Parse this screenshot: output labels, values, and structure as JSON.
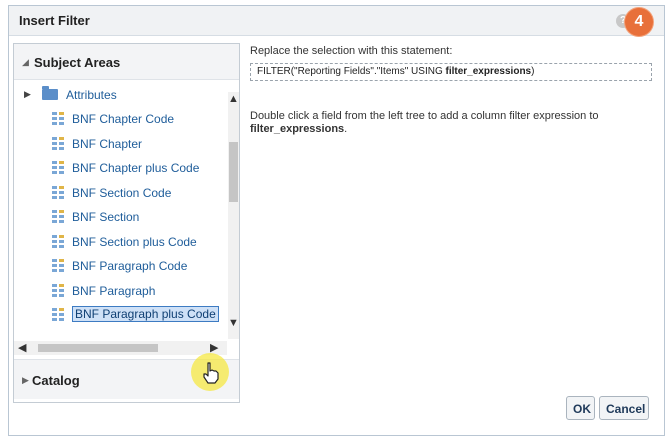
{
  "dialog": {
    "title": "Insert Filter",
    "help_glyph": "?",
    "step_badge": "4"
  },
  "left_panel": {
    "subject_areas_label": "Subject Areas",
    "catalog_label": "Catalog",
    "tree": {
      "folder": "Attributes",
      "items": [
        "BNF Chapter Code",
        "BNF Chapter",
        "BNF Chapter plus Code",
        "BNF Section Code",
        "BNF Section",
        "BNF Section plus Code",
        "BNF Paragraph Code",
        "BNF Paragraph",
        "BNF Paragraph plus Code"
      ],
      "selected_index": 8
    }
  },
  "right_panel": {
    "instruction": "Replace the selection with this statement:",
    "statement_prefix": "FILTER(\"Reporting Fields\".\"Items\" USING ",
    "statement_bold": "filter_expressions",
    "statement_suffix": ")",
    "help_line1": "Double click a field from the left tree to add a column filter expression to",
    "help_bold": "filter_expressions",
    "help_suffix": "."
  },
  "buttons": {
    "ok": "OK",
    "cancel": "Cancel"
  },
  "colors": {
    "badge": "#e8703a",
    "link_text": "#1f5d9a",
    "highlight": "#f5e83c"
  }
}
